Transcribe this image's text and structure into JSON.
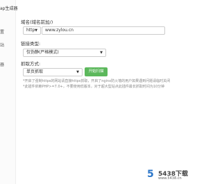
{
  "sidebar": {
    "header": "ap生成器",
    "items": [
      {
        "label": "置"
      },
      {
        "label": "站"
      },
      {
        "label": "器"
      }
    ]
  },
  "form": {
    "domain_label": "域名(域名前加/)",
    "protocol_value": "http",
    "domain_value": "www.zylou.cn",
    "link_type_label": "链接类型:",
    "link_type_value": "仅伪静(严格模式)",
    "crawl_mode_label": "抓取方式:",
    "crawl_mode_value": "单页抓取",
    "start_button": "开始扫描",
    "note_1": "*开启了强制https的网站请直接https抓取，开启了nginx防火墙的用户如果遇到问题请临时关闭",
    "note_2": "*此插件依赖PHP>=7.0+，不要使用低版本，对于超大型站点此插件最长抓取时间为10分钟"
  },
  "watermark": {
    "logo": "5",
    "brand": "5438下载",
    "url": "www.5438.cn"
  },
  "colors": {
    "button_green": "#5cb85c",
    "logo_blue": "#2b76c9"
  }
}
